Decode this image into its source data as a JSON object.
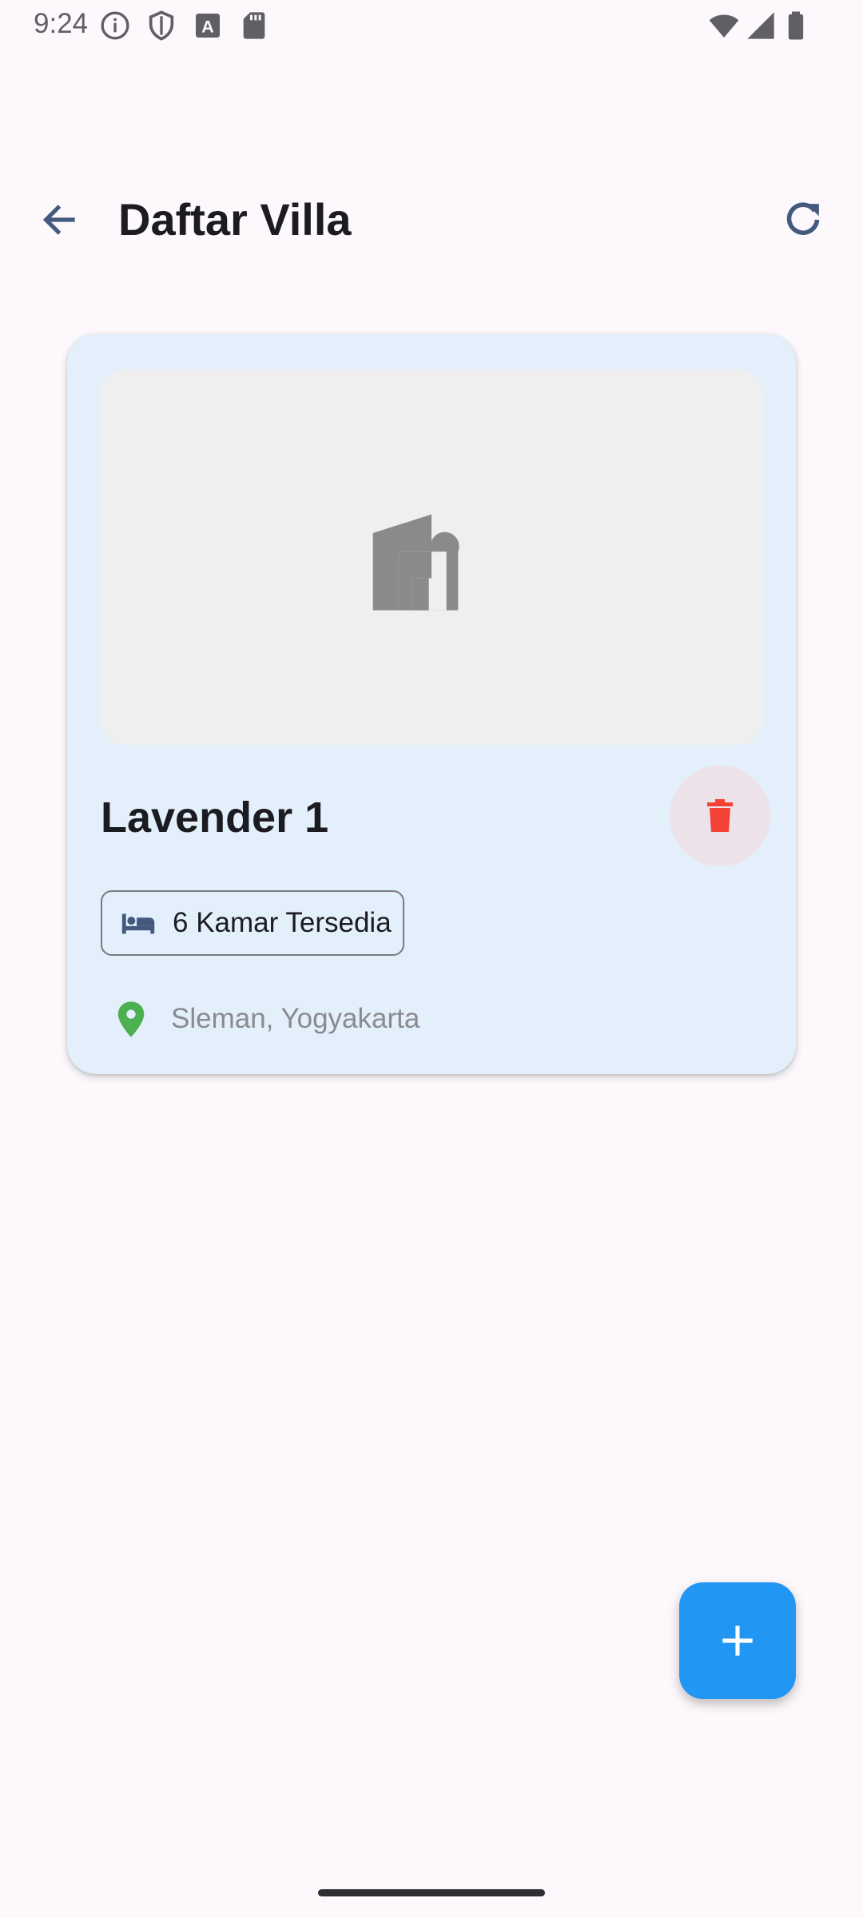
{
  "status_bar": {
    "time": "9:24",
    "left_icons": [
      "info-icon",
      "shield-icon",
      "text-a-icon",
      "sd-card-icon"
    ],
    "right_icons": [
      "wifi-icon",
      "signal-icon",
      "battery-icon"
    ]
  },
  "app_bar": {
    "back_icon": "arrow-back-icon",
    "title": "Daftar Villa",
    "refresh_icon": "refresh-icon"
  },
  "villas": [
    {
      "image_placeholder_icon": "house-icon",
      "name": "Lavender 1",
      "rooms_label": "6 Kamar Tersedia",
      "rooms_icon": "bed-icon",
      "location": "Sleman, Yogyakarta",
      "location_icon": "location-pin-icon",
      "delete_icon": "trash-icon"
    }
  ],
  "fab": {
    "icon": "plus-icon"
  },
  "colors": {
    "background": "#fcf8fc",
    "card": "#e3f0fb",
    "accent": "#2196f3",
    "icon_navy": "#44597e",
    "delete_red": "#f44336",
    "pin_green": "#4caf50"
  }
}
